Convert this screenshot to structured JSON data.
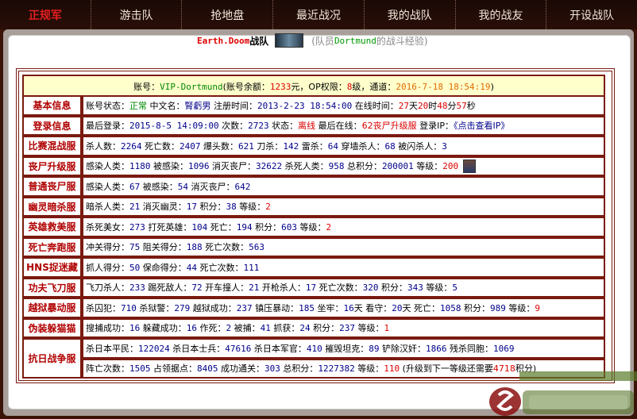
{
  "nav": [
    {
      "label": "正规军",
      "active": true
    },
    {
      "label": "游击队",
      "active": false
    },
    {
      "label": "抢地盘",
      "active": false
    },
    {
      "label": "最近战况",
      "active": false
    },
    {
      "label": "我的战队",
      "active": false
    },
    {
      "label": "我的战友",
      "active": false
    },
    {
      "label": "开设战队",
      "active": false
    }
  ],
  "team": {
    "name": "Earth.Doom",
    "name_suffix": "战队",
    "desc_prefix": "(队员",
    "member": "Dortmund",
    "desc_suffix": "的战斗经验)"
  },
  "account": {
    "l1": "账号：",
    "account_name": "VIP-Dortmund",
    "l2": "(账号余额：",
    "balance": "1233",
    "l3": "元，OP权限：",
    "op_level": "8",
    "l4": "级，通道：",
    "channel_time": "2016-7-18 18:54:19",
    "l5": ")"
  },
  "rows": {
    "basic": {
      "label": "基本信息",
      "s1": "账号状态：",
      "status": "正常",
      "s2": " 中文名：",
      "cn_name": "腎虧男",
      "s3": " 注册时间：",
      "reg_time": "2013-2-23 18:54:00",
      "s4": " 在线时间：",
      "d": "27",
      "s5": "天",
      "h": "20",
      "s6": "时",
      "m": "48",
      "s7": "分",
      "s": "57",
      "s8": "秒"
    },
    "login": {
      "label": "登录信息",
      "s1": "最后登录：",
      "last_login": "2015-8-5 14:09:00",
      "s2": " 次数：",
      "count": "2723",
      "s3": " 状态：",
      "state": "离线",
      "s4": " 最后在线：",
      "server": "62丧尸升级服",
      "s5": " 登录IP：",
      "ip_link": "《点击查看IP》"
    },
    "match": {
      "label": "比赛混战服",
      "s1": "杀人数：",
      "v1": "2264",
      "s2": " 死亡数：",
      "v2": "2407",
      "s3": " 爆头数：",
      "v3": "621",
      "s4": " 刀杀：",
      "v4": "142",
      "s5": " 雷杀：",
      "v5": "64",
      "s6": " 穿墙杀人：",
      "v6": "68",
      "s7": " 被闪杀人：",
      "v7": "3"
    },
    "zombie_up": {
      "label": "丧尸升级服",
      "s1": "感染人类：",
      "v1": "1180",
      "s2": " 被感染：",
      "v2": "1096",
      "s3": " 消灭丧尸：",
      "v3": "32622",
      "s4": " 杀死人类：",
      "v4": "958",
      "s5": " 总积分：",
      "v5": "200001",
      "s6": " 等级：",
      "v6": "200"
    },
    "zombie_normal": {
      "label": "普通丧尸服",
      "s1": "感染人类：",
      "v1": "67",
      "s2": " 被感染：",
      "v2": "54",
      "s3": " 消灭丧尸：",
      "v3": "642"
    },
    "ghost": {
      "label": "幽灵暗杀服",
      "s1": "暗杀人类：",
      "v1": "21",
      "s2": " 消灭幽灵：",
      "v2": "17",
      "s3": " 积分：",
      "v3": "38",
      "s4": " 等级：",
      "v4": "2"
    },
    "hero": {
      "label": "英雄救美服",
      "s1": "杀死美女：",
      "v1": "273",
      "s2": " 打死英雄：",
      "v2": "104",
      "s3": " 死亡：",
      "v3": "194",
      "s4": " 积分：",
      "v4": "603",
      "s5": " 等级：",
      "v5": "2"
    },
    "death_run": {
      "label": "死亡奔跑服",
      "s1": "冲关得分：",
      "v1": "75",
      "s2": " 阻关得分：",
      "v2": "188",
      "s3": " 死亡次数：",
      "v3": "563"
    },
    "hns": {
      "label": "HNS捉迷藏",
      "s1": "抓人得分：",
      "v1": "50",
      "s2": " 保命得分：",
      "v2": "44",
      "s3": " 死亡次数：",
      "v3": "111"
    },
    "kungfu": {
      "label": "功夫飞刀服",
      "s1": "飞刀杀人：",
      "v1": "233",
      "s2": " 踢死敌人：",
      "v2": "72",
      "s3": " 开车撞人：",
      "v3": "21",
      "s4": " 开枪杀人：",
      "v4": "17",
      "s5": " 死亡次数：",
      "v5": "320",
      "s6": " 积分：",
      "v6": "343",
      "s7": " 等级：",
      "v7": "5"
    },
    "prison": {
      "label": "越狱暴动服",
      "s1": "杀囚犯：",
      "v1": "710",
      "s2": " 杀狱警：",
      "v2": "279",
      "s3": " 越狱成功：",
      "v3": "237",
      "s4": " 镇压暴动：",
      "v4": "185",
      "s5": " 坐牢：",
      "v5": "16",
      "s6": "天 看守：",
      "v6": "20",
      "s7": "天 死亡：",
      "v7": "1058",
      "s8": " 积分：",
      "v8": "989",
      "s9": " 等级：",
      "v9": "9"
    },
    "disguise": {
      "label": "伪装躲猫猫",
      "s1": "搜捕成功：",
      "v1": "16",
      "s2": " 躲藏成功：",
      "v2": "16",
      "s3": " 作死：",
      "v3": "2",
      "s4": " 被捕：",
      "v4": "41",
      "s5": " 抓获：",
      "v5": "24",
      "s6": " 积分：",
      "v6": "237",
      "s7": " 等级：",
      "v7": "1"
    },
    "war": {
      "label": "抗日战争服",
      "line1": {
        "s1": "杀日本平民：",
        "v1": "122024",
        "s2": " 杀日本士兵：",
        "v2": "47616",
        "s3": " 杀日本军官：",
        "v3": "410",
        "s4": " 摧毁坦克：",
        "v4": "89",
        "s5": " 铲除汉奸：",
        "v5": "1866",
        "s6": " 残杀同胞：",
        "v6": "1069"
      },
      "line2": {
        "s1": "阵亡次数：",
        "v1": "1505",
        "s2": " 占领据点：",
        "v2": "8405",
        "s3": " 成功通关：",
        "v3": "303",
        "s4": " 总积分：",
        "v4": "1227382",
        "s5": " 等级：",
        "v5": "110",
        "s6": " (升级到下一等级还需要",
        "v6": "4718",
        "s7": "积分)"
      }
    }
  }
}
